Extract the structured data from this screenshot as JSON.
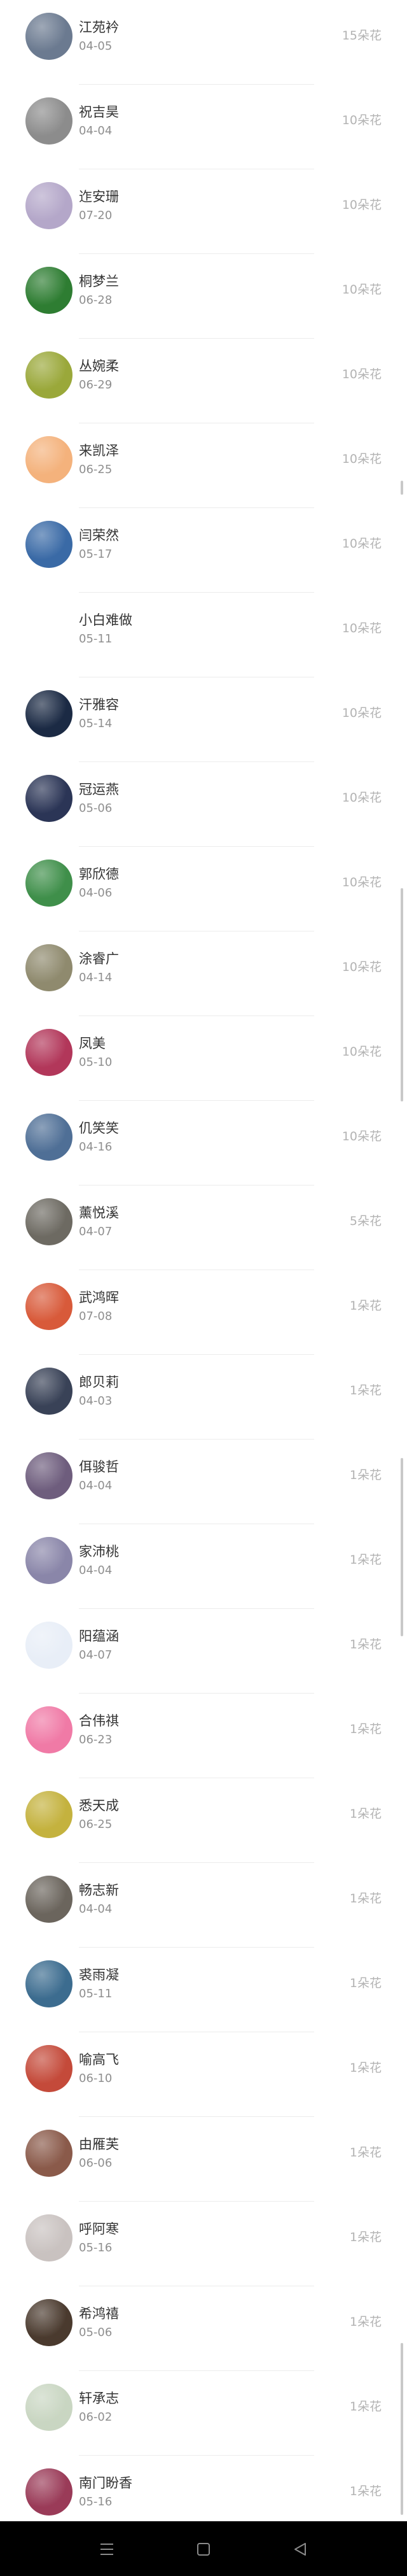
{
  "entries": [
    {
      "name": "江苑衿",
      "date": "04-05",
      "flowers": "15朵花",
      "icon": "avatar-icon",
      "color": "#6b7a90"
    },
    {
      "name": "祝吉昊",
      "date": "04-04",
      "flowers": "10朵花",
      "icon": "avatar-icon",
      "color": "#8c8c8c"
    },
    {
      "name": "迮安珊",
      "date": "07-20",
      "flowers": "10朵花",
      "icon": "avatar-icon",
      "color": "#b4a7c9"
    },
    {
      "name": "桐梦兰",
      "date": "06-28",
      "flowers": "10朵花",
      "icon": "frog-icon",
      "color": "#2e7d32"
    },
    {
      "name": "丛婉柔",
      "date": "06-29",
      "flowers": "10朵花",
      "icon": "avatar-icon",
      "color": "#9aa83a"
    },
    {
      "name": "来凯泽",
      "date": "06-25",
      "flowers": "10朵花",
      "icon": "cartoon-icon",
      "color": "#f4b27c"
    },
    {
      "name": "闫荣然",
      "date": "05-17",
      "flowers": "10朵花",
      "icon": "avatar-icon",
      "color": "#3a6aa6"
    },
    {
      "name": "小白难做",
      "date": "05-11",
      "flowers": "10朵花",
      "icon": "",
      "color": ""
    },
    {
      "name": "汗雅容",
      "date": "05-14",
      "flowers": "10朵花",
      "icon": "snowflake-icon",
      "color": "#1b2a44"
    },
    {
      "name": "冠运燕",
      "date": "05-06",
      "flowers": "10朵花",
      "icon": "avatar-icon",
      "color": "#2b3556"
    },
    {
      "name": "郭欣德",
      "date": "04-06",
      "flowers": "10朵花",
      "icon": "cartoon-icon",
      "color": "#3f8f4a"
    },
    {
      "name": "涂睿广",
      "date": "04-14",
      "flowers": "10朵花",
      "icon": "avatar-icon",
      "color": "#8f8a6e"
    },
    {
      "name": "凤美",
      "date": "05-10",
      "flowers": "10朵花",
      "icon": "avatar-icon",
      "color": "#b2375a"
    },
    {
      "name": "仉笑笑",
      "date": "04-16",
      "flowers": "10朵花",
      "icon": "avatar-icon",
      "color": "#4f6f96"
    },
    {
      "name": "薰悦溪",
      "date": "04-07",
      "flowers": "5朵花",
      "icon": "avatar-icon",
      "color": "#6d6a62"
    },
    {
      "name": "武鸿晖",
      "date": "07-08",
      "flowers": "1朵花",
      "icon": "pencils-icon",
      "color": "#d85a3a"
    },
    {
      "name": "郎贝莉",
      "date": "04-03",
      "flowers": "1朵花",
      "icon": "avatar-icon",
      "color": "#394257"
    },
    {
      "name": "佴骏哲",
      "date": "04-04",
      "flowers": "1朵花",
      "icon": "avatar-icon",
      "color": "#6e5d7d"
    },
    {
      "name": "家沛桃",
      "date": "04-04",
      "flowers": "1朵花",
      "icon": "avatar-icon",
      "color": "#8a86a9"
    },
    {
      "name": "阳蕴涵",
      "date": "04-07",
      "flowers": "1朵花",
      "icon": "cartoon-icon",
      "color": "#e8eef7"
    },
    {
      "name": "合伟祺",
      "date": "06-23",
      "flowers": "1朵花",
      "icon": "cartoon-icon",
      "color": "#f07aa6"
    },
    {
      "name": "悉天成",
      "date": "06-25",
      "flowers": "1朵花",
      "icon": "flower-icon",
      "color": "#c4b23e"
    },
    {
      "name": "畅志新",
      "date": "04-04",
      "flowers": "1朵花",
      "icon": "avatar-icon",
      "color": "#6b655d"
    },
    {
      "name": "裘雨凝",
      "date": "05-11",
      "flowers": "1朵花",
      "icon": "avatar-icon",
      "color": "#3c6c8f"
    },
    {
      "name": "喻高飞",
      "date": "06-10",
      "flowers": "1朵花",
      "icon": "cartoon-icon",
      "color": "#c44a3a"
    },
    {
      "name": "由雁芙",
      "date": "06-06",
      "flowers": "1朵花",
      "icon": "bus-icon",
      "color": "#8a5a4a"
    },
    {
      "name": "呼阿寒",
      "date": "05-16",
      "flowers": "1朵花",
      "icon": "avatar-icon",
      "color": "#c9c2c0"
    },
    {
      "name": "希鸿禧",
      "date": "05-06",
      "flowers": "1朵花",
      "icon": "avatar-icon",
      "color": "#4a3a2e"
    },
    {
      "name": "轩承志",
      "date": "06-02",
      "flowers": "1朵花",
      "icon": "plant-icon",
      "color": "#c9d6c2"
    },
    {
      "name": "南门盼香",
      "date": "05-16",
      "flowers": "1朵花",
      "icon": "avatar-icon",
      "color": "#9a3b58"
    }
  ],
  "navbar": {
    "menu_icon": "menu-icon",
    "home_icon": "home-square-icon",
    "back_icon": "back-triangle-icon"
  }
}
